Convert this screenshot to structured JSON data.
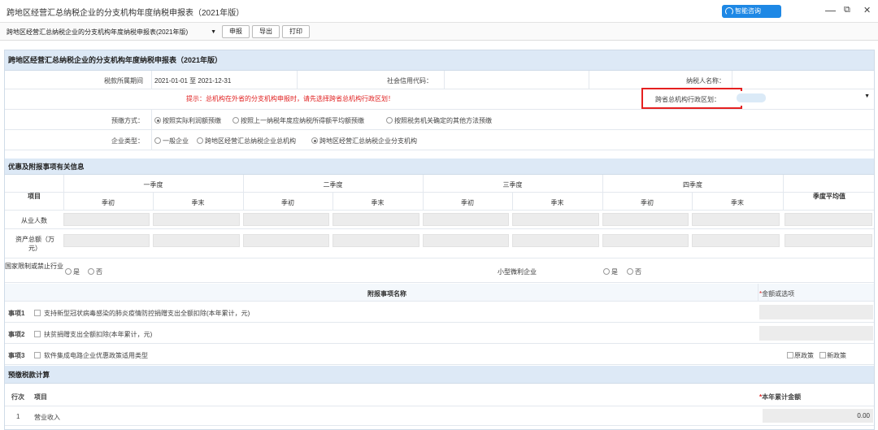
{
  "window": {
    "title": "跨地区经营汇总纳税企业的分支机构年度纳税申报表（2021年版）",
    "smart_btn": "智能咨询",
    "min": "—",
    "max": "⧉",
    "close": "✕"
  },
  "toolbar": {
    "selector": "跨地区经营汇总纳税企业的分支机构年度纳税申报表(2021年版)",
    "caret": "▼",
    "declare": "申报",
    "export": "导出",
    "print": "打印"
  },
  "form": {
    "heading": "跨地区经营汇总纳税企业的分支机构年度纳税申报表（2021年版）",
    "period_label": "税款所属期间",
    "period_value": "2021-01-01 至 2021-12-31",
    "credit_code_label": "社会信用代码：",
    "taxpayer_name_label": "纳税人名称：",
    "notice": "提示：总机构在外省的分支机构申报时，请先选择跨省总机构行政区划！",
    "region_label": "跨省总机构行政区划：",
    "region_caret": "▼",
    "prepay_label": "预缴方式：",
    "prepay_options": [
      "按照实际利润额预缴",
      "按照上一纳税年度应纳税所得额平均额预缴",
      "按照税务机关确定的其他方法预缴"
    ],
    "type_label": "企业类型：",
    "type_options": [
      "一般企业",
      "跨地区经营汇总纳税企业总机构",
      "跨地区经营汇总纳税企业分支机构"
    ]
  },
  "preferential": {
    "section": "优惠及附报事项有关信息",
    "item_col": "项目",
    "quarters": [
      "一季度",
      "二季度",
      "三季度",
      "四季度"
    ],
    "begin": "季初",
    "end": "季末",
    "avg": "季度平均值",
    "employees": "从业人数",
    "assets": "资产总额（万元）",
    "restricted": "国家限制或禁止行业",
    "small_micro": "小型微利企业",
    "yes": "是",
    "no": "否"
  },
  "attached": {
    "name_col": "附报事项名称",
    "amount_col": "金额或选项",
    "required_mark": "*",
    "items": [
      {
        "no": "事项1",
        "text": "支持新型冠状病毒感染的肺炎疫情防控捐赠支出全额扣除(本年累计，元)"
      },
      {
        "no": "事项2",
        "text": "扶贫捐赠支出全额扣除(本年累计，元)"
      },
      {
        "no": "事项3",
        "text": "软件集成电路企业优惠政策适用类型"
      }
    ],
    "old_policy": "原政策",
    "new_policy": "新政策"
  },
  "calc": {
    "section": "预缴税款计算",
    "row_col": "行次",
    "item_col": "项目",
    "amount_col": "本年累计金额",
    "rows": [
      {
        "no": "1",
        "item": "营业收入",
        "amount": "0.00"
      }
    ]
  }
}
